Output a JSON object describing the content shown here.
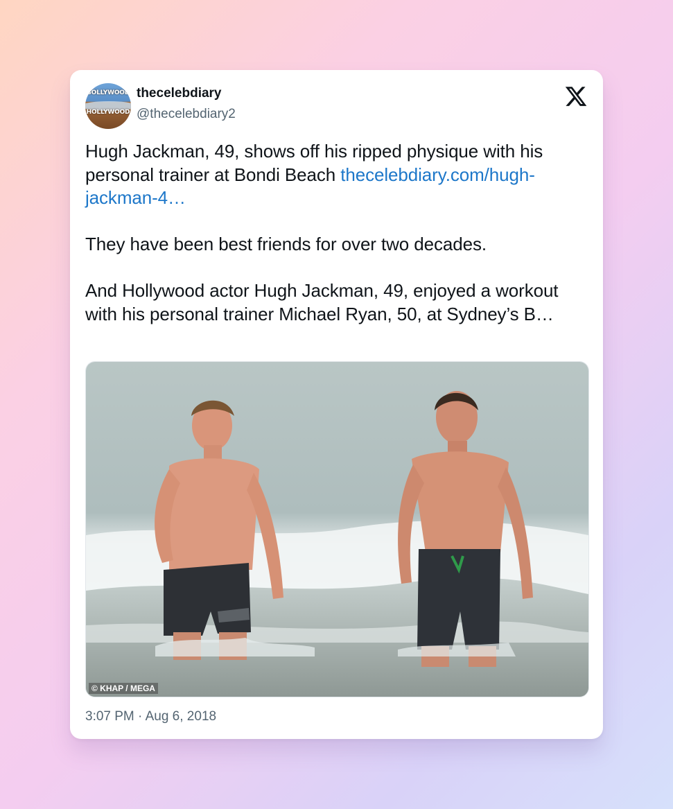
{
  "tweet": {
    "author": {
      "display_name": "thecelebdiary",
      "handle": "@thecelebdiary2",
      "avatar_sign_top": "BOLLYWOOD",
      "avatar_sign_bottom": "HOLLYWOOD"
    },
    "platform_icon": "x-logo-icon",
    "text": {
      "para1_before_link": "Hugh Jackman, 49, shows off his ripped physique with his personal trainer at Bondi Beach ",
      "para1_link": "thecelebdiary.com/hugh-jackman-4…",
      "para2": "They have been best friends for over two decades.",
      "para3": "And Hollywood actor Hugh Jackman, 49, enjoyed a workout with his personal trainer Michael Ryan, 50, at Sydney’s B…"
    },
    "photo": {
      "credit": "© KHAP / MEGA"
    },
    "timestamp": "3:07 PM · Aug 6, 2018"
  },
  "colors": {
    "link": "#1d77c9",
    "text_primary": "#0f1419",
    "text_secondary": "#536471",
    "card_bg": "#ffffff"
  }
}
